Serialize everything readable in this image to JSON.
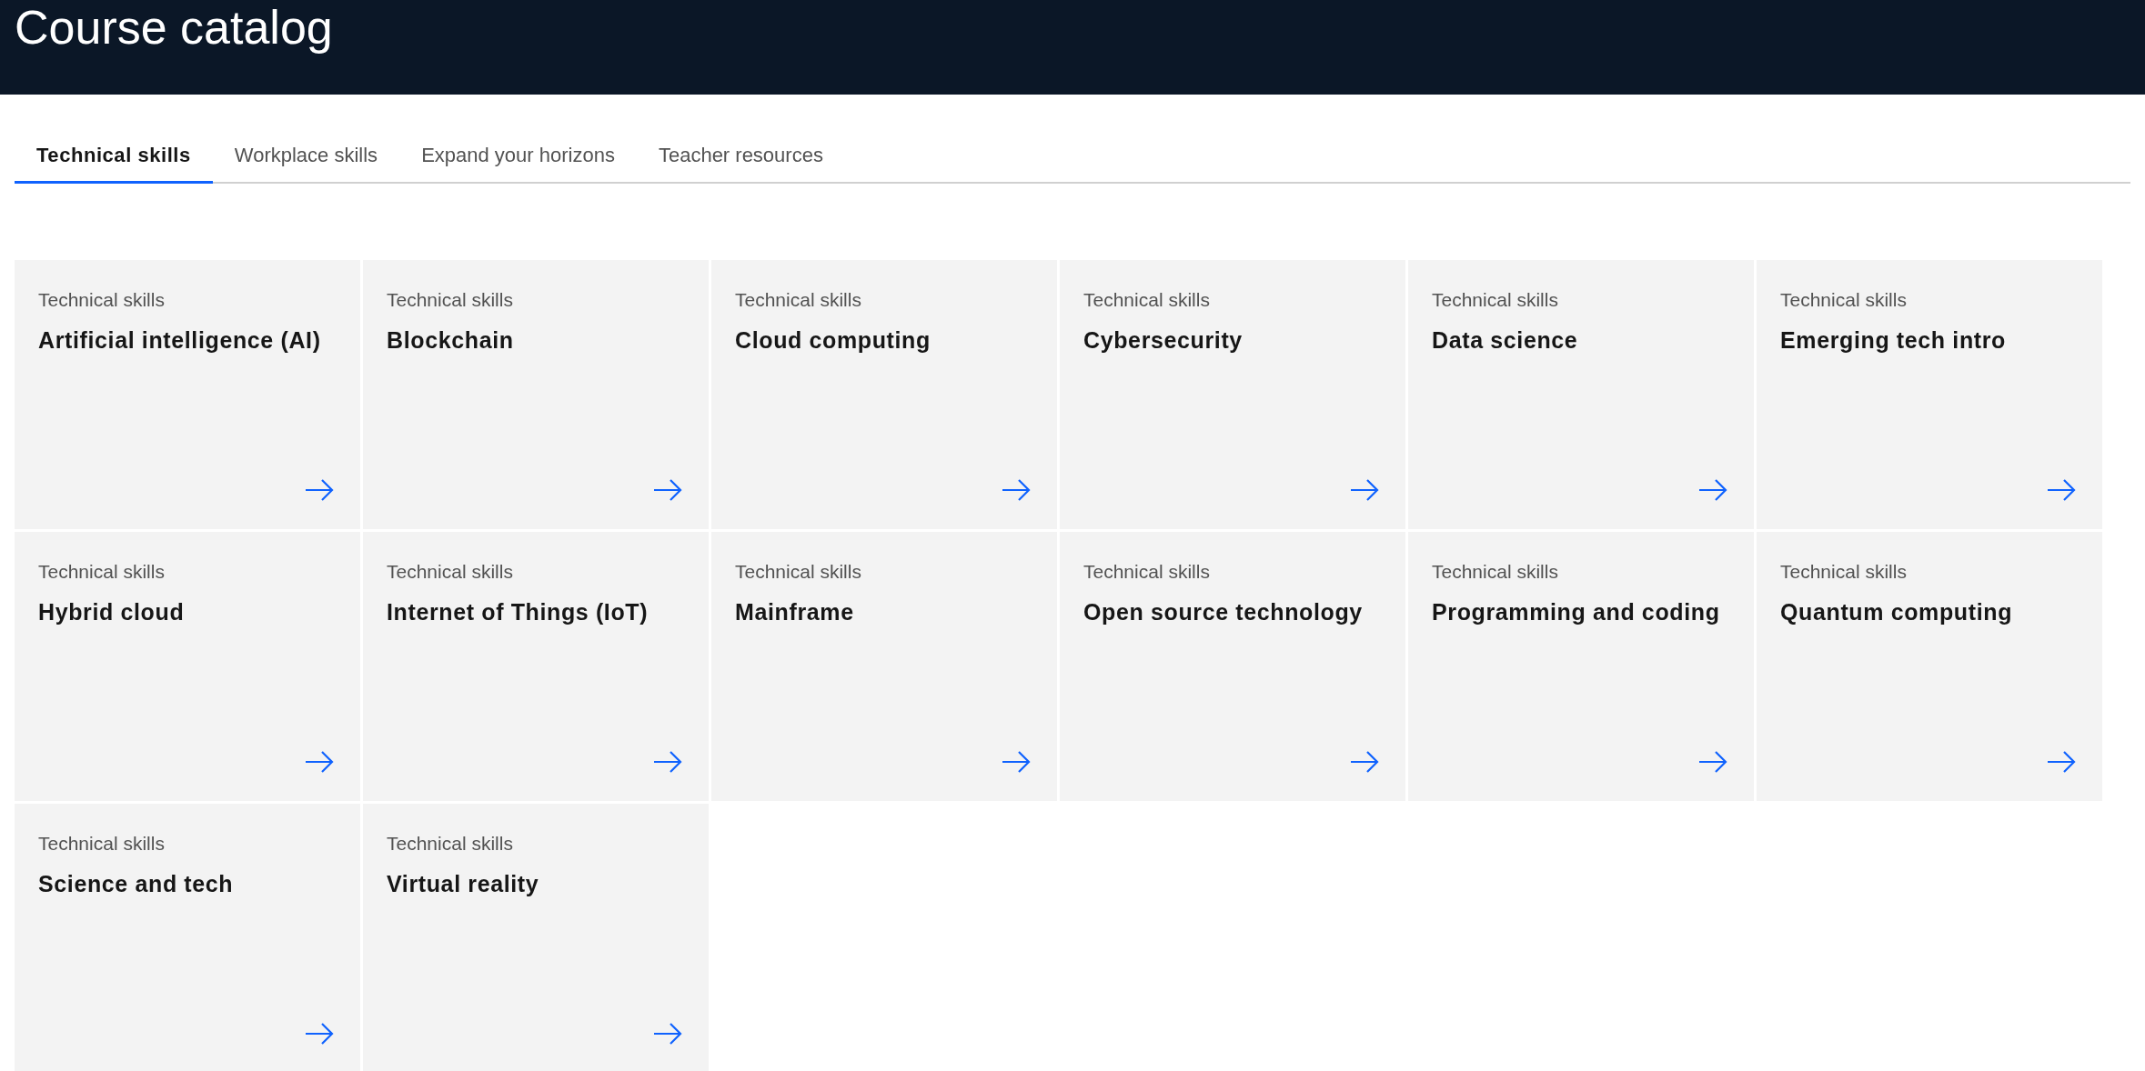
{
  "header": {
    "title": "Course catalog"
  },
  "tabs": [
    {
      "label": "Technical skills",
      "selected": true
    },
    {
      "label": "Workplace skills",
      "selected": false
    },
    {
      "label": "Expand your horizons",
      "selected": false
    },
    {
      "label": "Teacher resources",
      "selected": false
    }
  ],
  "cards": [
    {
      "category": "Technical skills",
      "title": "Artificial intelligence (AI)"
    },
    {
      "category": "Technical skills",
      "title": "Blockchain"
    },
    {
      "category": "Technical skills",
      "title": "Cloud computing"
    },
    {
      "category": "Technical skills",
      "title": "Cybersecurity"
    },
    {
      "category": "Technical skills",
      "title": "Data science"
    },
    {
      "category": "Technical skills",
      "title": "Emerging tech intro"
    },
    {
      "category": "Technical skills",
      "title": "Hybrid cloud"
    },
    {
      "category": "Technical skills",
      "title": "Internet of Things (IoT)"
    },
    {
      "category": "Technical skills",
      "title": "Mainframe"
    },
    {
      "category": "Technical skills",
      "title": "Open source technology"
    },
    {
      "category": "Technical skills",
      "title": "Programming and coding"
    },
    {
      "category": "Technical skills",
      "title": "Quantum computing"
    },
    {
      "category": "Technical skills",
      "title": "Science and tech"
    },
    {
      "category": "Technical skills",
      "title": "Virtual reality"
    }
  ]
}
